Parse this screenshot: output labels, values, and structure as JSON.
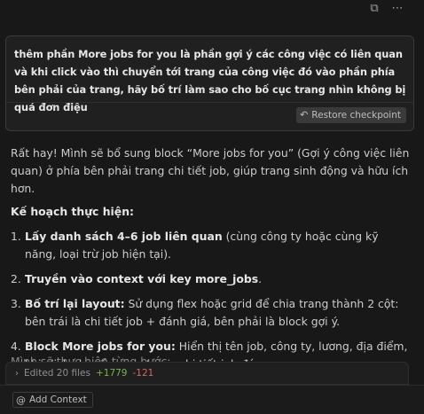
{
  "toolbar": {
    "copy_icon": "copy-icon",
    "more_icon": "more-icon"
  },
  "user_message": {
    "text": "thêm phần More jobs for you là phần gợi ý các công việc có liên quan và khi click vào thì chuyển tới trang của công việc đó vào phần phía bên phải của trang, hãy bố trí làm sao cho bố cục trang nhìn không bị quá đơn điệu",
    "restore_label": "Restore checkpoint"
  },
  "reply": {
    "intro": "Rất hay! Mình sẽ bổ sung block “More jobs for you” (Gợi ý công việc liên quan) ở phía bên phải trang chi tiết job, giúp trang sinh động và hữu ích hơn.",
    "plan_heading": "Kế hoạch thực hiện:",
    "plan": [
      {
        "num": "1.",
        "bold": "Lấy danh sách 4–6 job liên quan",
        "rest": " (cùng công ty hoặc cùng kỹ năng, loại trừ job hiện tại)."
      },
      {
        "num": "2.",
        "bold": "Truyền vào context với key more_jobs",
        "rest": "."
      },
      {
        "num": "3.",
        "bold": "Bố trí lại layout:",
        "rest": " Sử dụng flex hoặc grid để chia trang thành 2 cột: bên trái là chi tiết job + đánh giá, bên phải là block gợi ý."
      },
      {
        "num": "4.",
        "bold": "Block More jobs for you:",
        "rest": " Hiển thị tên job, công ty, lương, địa điểm, khi click chuyển sang trang chi tiết job đó."
      }
    ],
    "cutoff_text": "Mình sẽ thực hiện từng bước:"
  },
  "edited": {
    "label": "Edited 20 files",
    "added": "+1779",
    "removed": "-121"
  },
  "input": {
    "context_label": "Add Context"
  }
}
